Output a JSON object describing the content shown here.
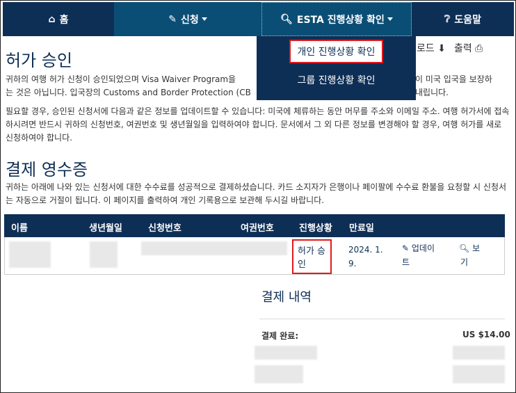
{
  "nav": {
    "home": "홈",
    "apply": "신청",
    "esta_status": "ESTA 진행상황 확인",
    "help": "도움말"
  },
  "dropdown": {
    "individual": "개인 진행상황 확인",
    "group": "그룹 진행상황 확인"
  },
  "tools": {
    "download": "로드",
    "print": "출력"
  },
  "title": "허가 승인",
  "paragraph1_line1": "귀하의 여행 허가 신청이 승인되었으며 Visa Waiver Program을",
  "paragraph1_line1_tail": "이 미국 입국을 보장하",
  "paragraph1_line2": "는 것은 아닙니다. 입국장의 Customs and Border Protection (CB",
  "paragraph1_line2_tail": "내립니다.",
  "paragraph2": "필요할 경우, 승인된 신청서에 다음과 같은 정보를 업데이트할 수 있습니다: 미국에 체류하는 동안 머무를 주소와 이메일 주소. 여행 허가서에 접속하시려면 반드시 귀하의 신청번호, 여권번호 및 생년월일을 입력하여야 합니다. 문서에서 그 외 다른 정보를 변경해야 할 경우, 여행 허가를 새로 신청하여야 합니다.",
  "section_title": "결제 영수증",
  "paragraph3": "귀하는 아래에 나와 있는 신청서에 대한 수수료를 성공적으로 결제하셨습니다. 카드 소지자가 은행이나 페이팔에 수수료 환불을 요청할 시 신청서는 자동으로 거절이 됩니다. 이 페이지를 출력하여 개인 기록용으로 보관해 두시길 바랍니다.",
  "table": {
    "headers": [
      "이름",
      "생년월일",
      "신청번호",
      "여권번호",
      "진행상황",
      "만료일"
    ],
    "row": {
      "status_line1": "허가 승",
      "status_line2": "인",
      "expiry_line1": "2024. 1.",
      "expiry_line2": "9.",
      "update_line1": "업데이",
      "update_line2": "트",
      "view_line1": "보",
      "view_line2": "기"
    }
  },
  "payment": {
    "title": "결제 내역",
    "label": "결제 완료:",
    "amount": "US $14.00"
  },
  "colors": {
    "navy": "#0e2f55",
    "teal": "#0b4e75",
    "highlight": "#e0191e"
  }
}
